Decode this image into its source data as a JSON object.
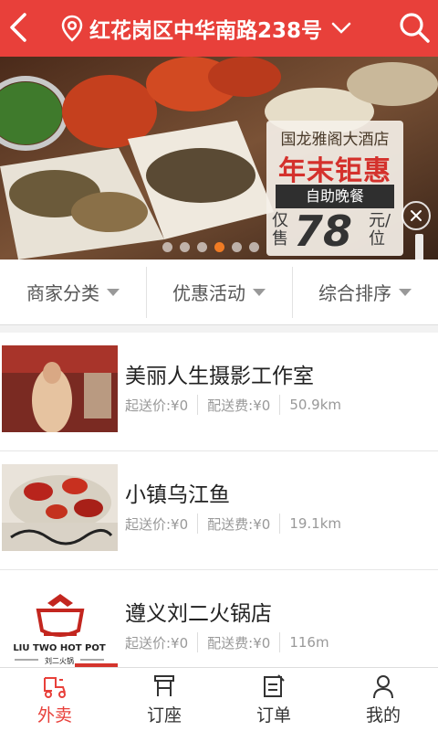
{
  "header": {
    "location": "红花岗区中华南路238号",
    "accent": "#e8403a"
  },
  "banner": {
    "hotel": "国龙雅阁大酒店",
    "sale": "年末钜惠",
    "buffet": "自助晚餐",
    "only": "仅售",
    "price": "78",
    "unit": "元/位",
    "slide_count": 6,
    "active_slide": 3
  },
  "filters": [
    {
      "label": "商家分类"
    },
    {
      "label": "优惠活动"
    },
    {
      "label": "综合排序"
    }
  ],
  "shops": [
    {
      "name": "美丽人生摄影工作室",
      "min_order": "起送价:¥0",
      "delivery_fee": "配送费:¥0",
      "distance": "50.9km"
    },
    {
      "name": "小镇乌江鱼",
      "min_order": "起送价:¥0",
      "delivery_fee": "配送费:¥0",
      "distance": "19.1km"
    },
    {
      "name": "遵义刘二火锅店",
      "min_order": "起送价:¥0",
      "delivery_fee": "配送费:¥0",
      "distance": "116m",
      "logo_text": "LIU TWO HOT POT",
      "logo_sub": "刘二火锅"
    }
  ],
  "tabs": [
    {
      "label": "外卖",
      "icon": "scooter-icon",
      "active": true
    },
    {
      "label": "订座",
      "icon": "seat-icon",
      "active": false
    },
    {
      "label": "订单",
      "icon": "order-icon",
      "active": false
    },
    {
      "label": "我的",
      "icon": "profile-icon",
      "active": false
    }
  ]
}
